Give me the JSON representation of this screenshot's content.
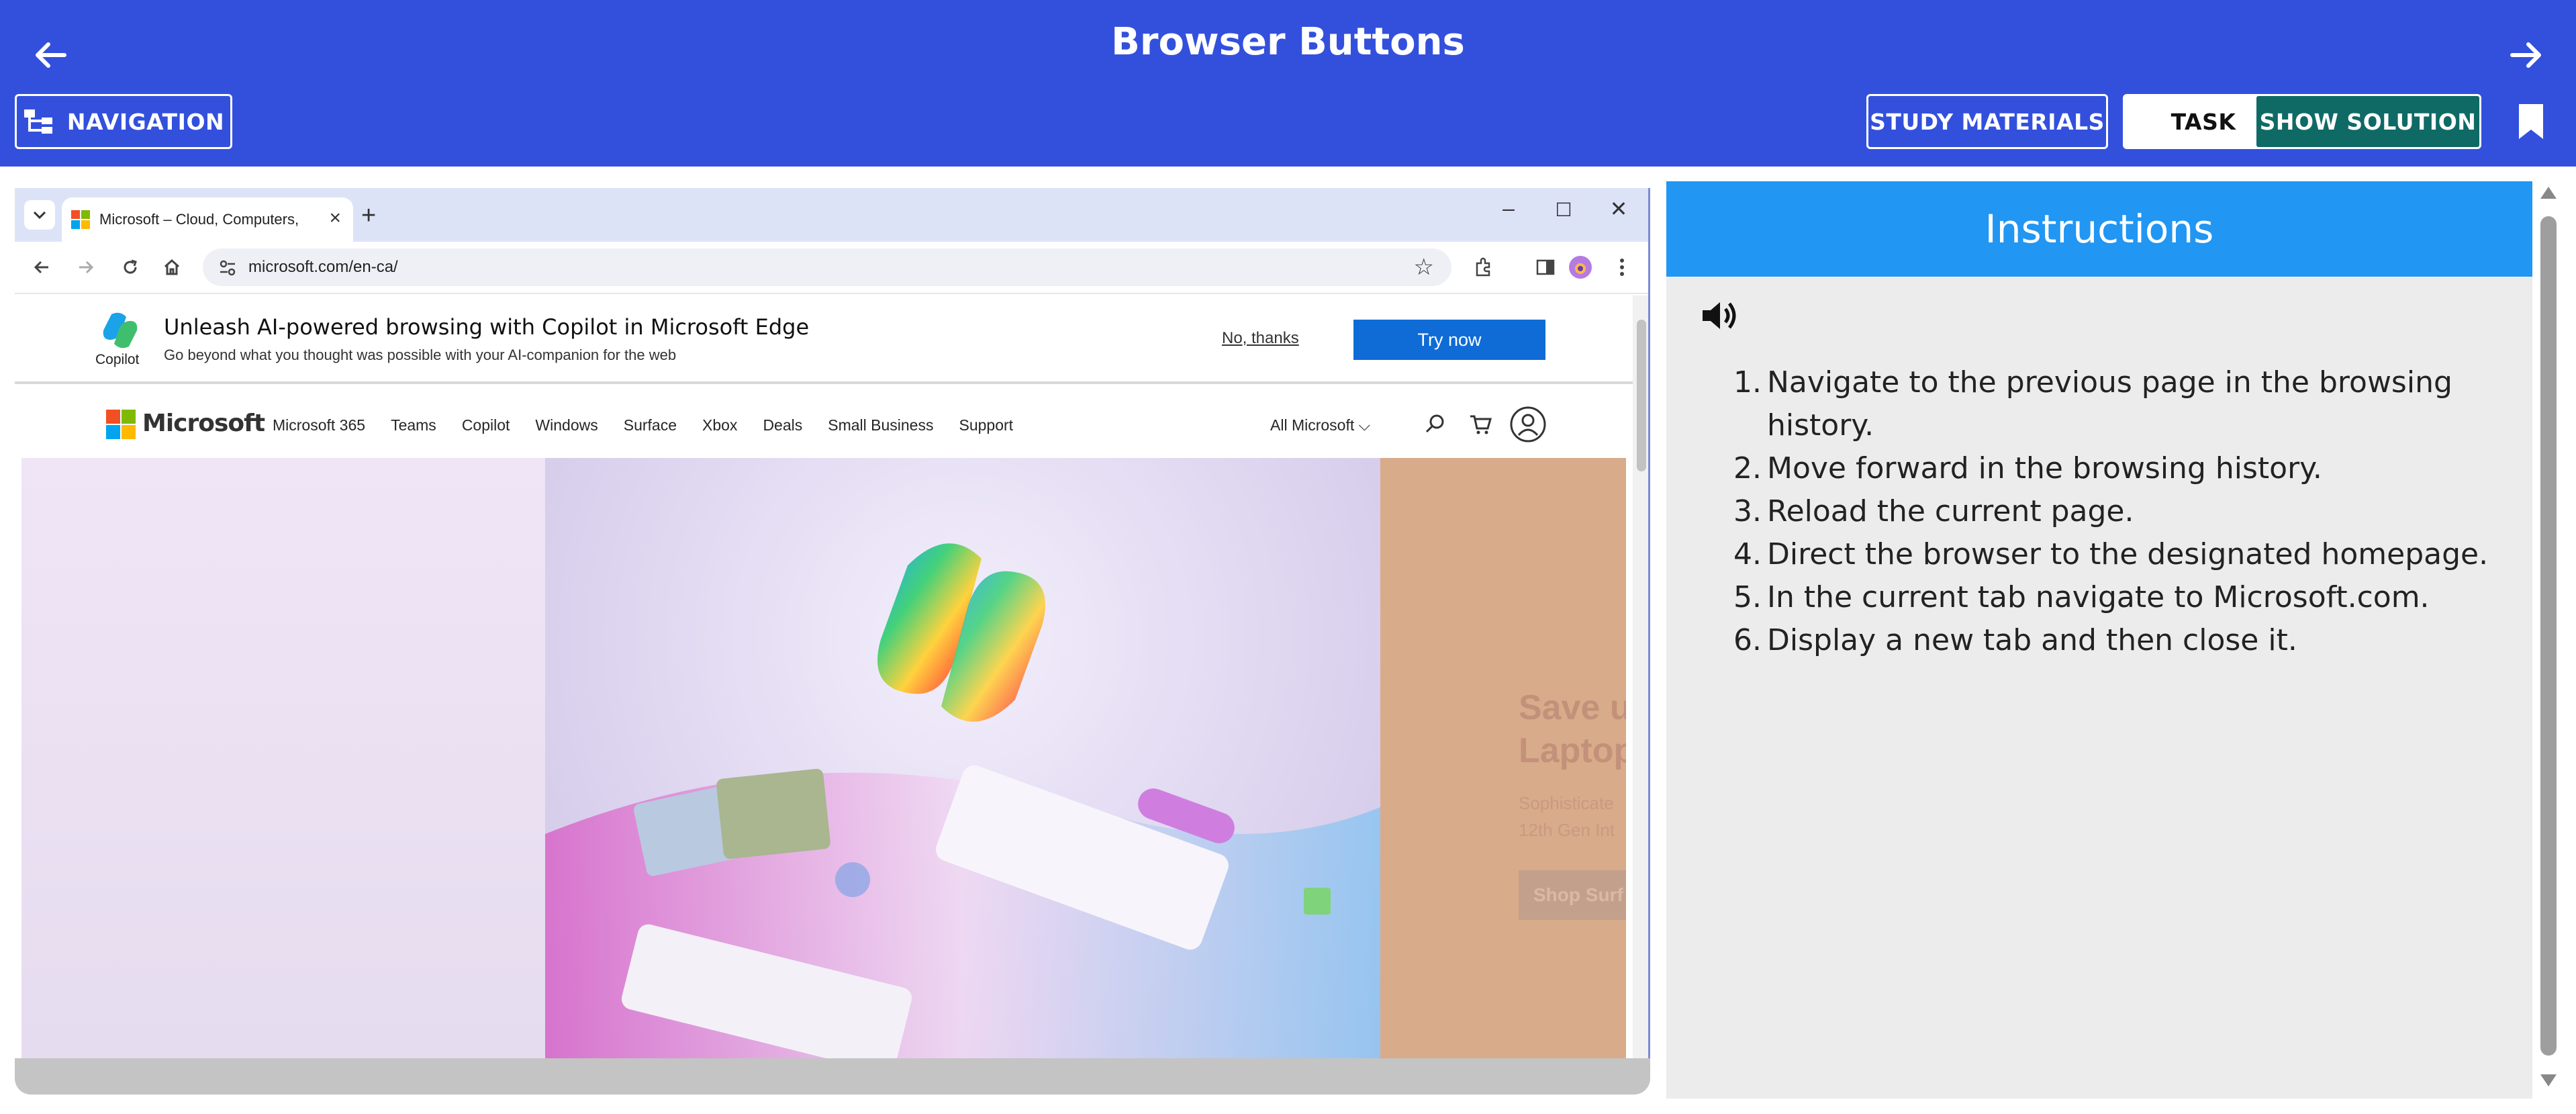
{
  "header": {
    "title": "Browser Buttons",
    "navigation_label": "NAVIGATION",
    "study_materials_label": "STUDY MATERIALS",
    "task_label": "TASK",
    "show_solution_label": "SHOW SOLUTION"
  },
  "browser": {
    "tab_title": "Microsoft – Cloud, Computers, ...",
    "address": "microsoft.com/en-ca/",
    "window_controls": [
      "–",
      "☐",
      "✕"
    ]
  },
  "promo": {
    "logo_label": "Copilot",
    "title": "Unleash AI-powered browsing with Copilot in Microsoft Edge",
    "subtitle": "Go beyond what you thought was possible with your AI-companion for the web",
    "no_thanks": "No, thanks",
    "try_now": "Try now"
  },
  "ms_nav": {
    "brand": "Microsoft",
    "links": [
      "Microsoft 365",
      "Teams",
      "Copilot",
      "Windows",
      "Surface",
      "Xbox",
      "Deals",
      "Small Business",
      "Support"
    ],
    "all_microsoft": "All Microsoft ⌵"
  },
  "hero": {
    "right_heading_line1": "Save u",
    "right_heading_line2": "Laptop",
    "right_text_line1": "Sophisticate",
    "right_text_line2": "12th Gen Int",
    "right_button": "Shop Surf"
  },
  "instructions": {
    "title": "Instructions",
    "items": [
      {
        "num": "1.",
        "text": "Navigate to the previous page in the browsing history."
      },
      {
        "num": "2.",
        "text": "Move forward in the browsing history."
      },
      {
        "num": "3.",
        "text": "Reload the current page."
      },
      {
        "num": "4.",
        "text": "Direct the browser to the designated homepage."
      },
      {
        "num": "5.",
        "text": "In the current tab navigate to Microsoft.com."
      },
      {
        "num": "6.",
        "text": "Display a new tab and then close it."
      }
    ]
  },
  "colors": {
    "header_bg": "#3350dd",
    "instructions_head": "#2196f3",
    "solution_button": "#0f6a66",
    "try_now": "#0f6cd6"
  }
}
